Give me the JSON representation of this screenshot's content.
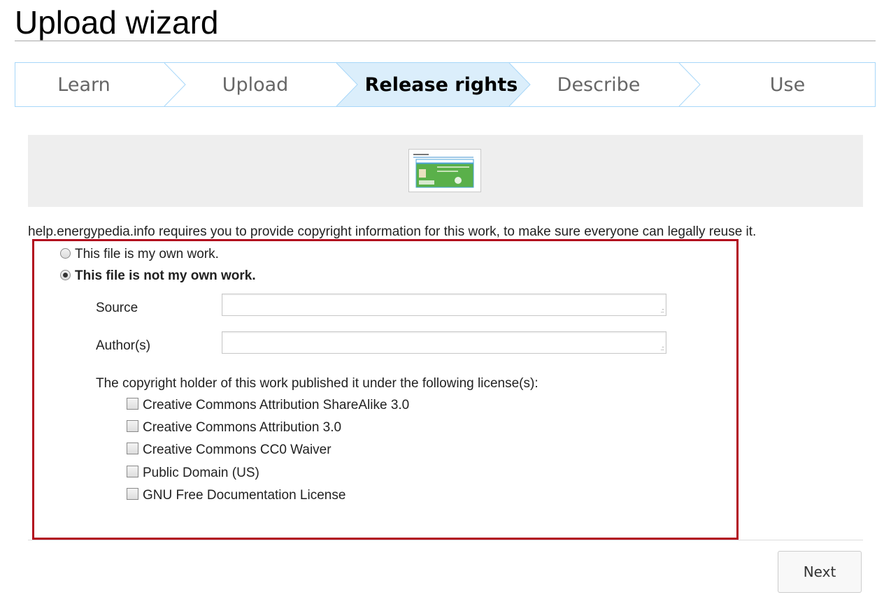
{
  "page": {
    "title": "Upload wizard"
  },
  "steps": [
    {
      "label": "Learn",
      "active": false
    },
    {
      "label": "Upload",
      "active": false
    },
    {
      "label": "Release rights",
      "active": true
    },
    {
      "label": "Describe",
      "active": false
    },
    {
      "label": "Use",
      "active": false
    }
  ],
  "intro_text": "help.energypedia.info requires you to provide copyright information for this work, to make sure everyone can legally reuse it.",
  "ownership": {
    "own_work_label": "This file is my own work.",
    "not_own_work_label": "This file is not my own work.",
    "selected": "not_own_work"
  },
  "fields": {
    "source_label": "Source",
    "source_value": "",
    "author_label": "Author(s)",
    "author_value": ""
  },
  "licenses": {
    "intro": "The copyright holder of this work published it under the following license(s):",
    "options": [
      {
        "label": "Creative Commons Attribution ShareAlike 3.0",
        "checked": false
      },
      {
        "label": "Creative Commons Attribution 3.0",
        "checked": false
      },
      {
        "label": "Creative Commons CC0 Waiver",
        "checked": false
      },
      {
        "label": "Public Domain (US)",
        "checked": false
      },
      {
        "label": "GNU Free Documentation License",
        "checked": false
      }
    ]
  },
  "actions": {
    "next_label": "Next"
  },
  "colors": {
    "step_border": "#a7d7f9",
    "step_active_bg": "#dbeefb",
    "highlight_border": "#b20a1e"
  }
}
